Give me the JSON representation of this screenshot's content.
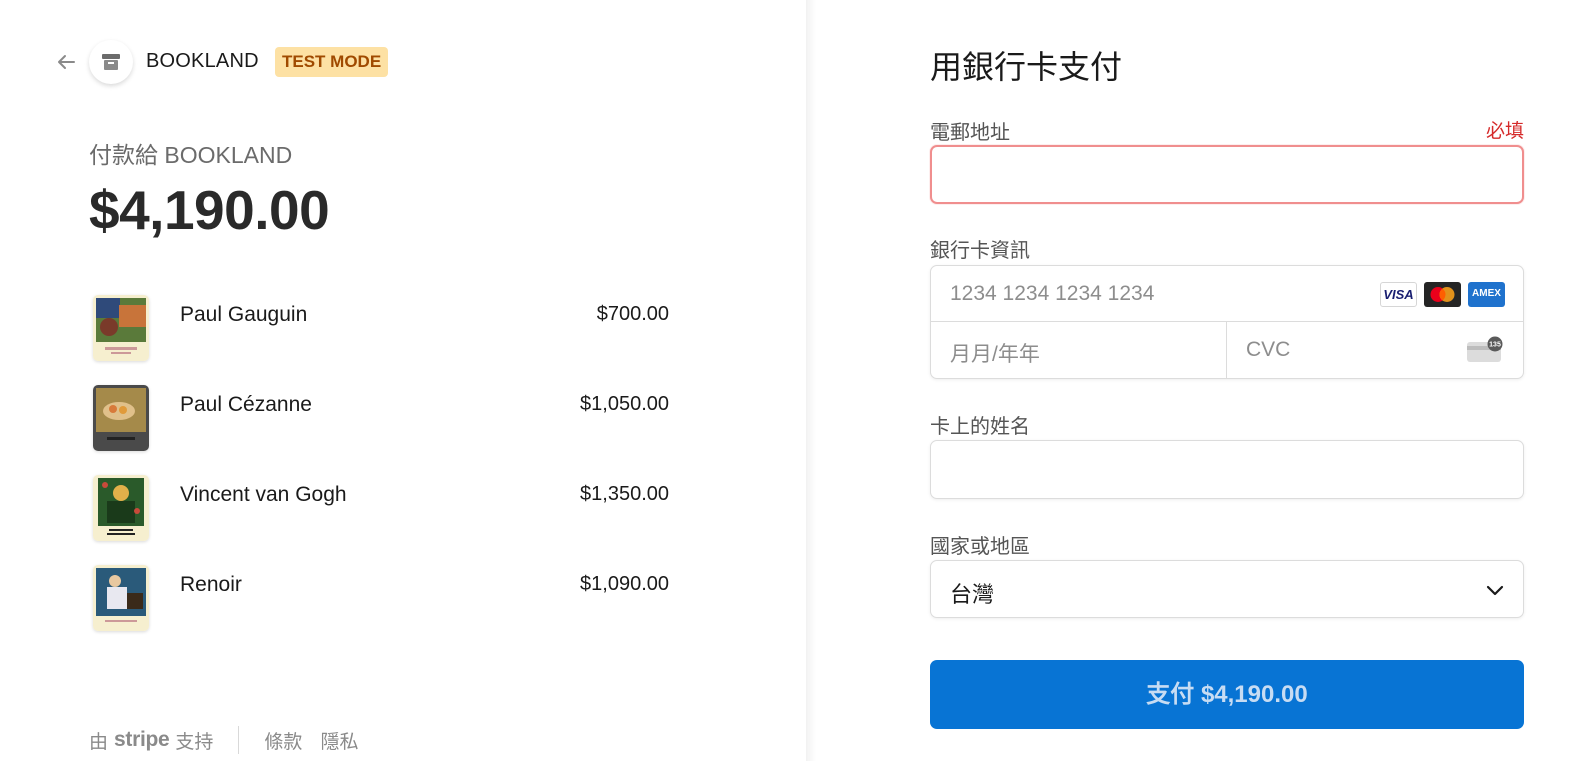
{
  "merchant": {
    "name": "BOOKLAND",
    "badge": "TEST MODE"
  },
  "summary": {
    "pay_to": "付款給 BOOKLAND",
    "total": "$4,190.00"
  },
  "items": [
    {
      "name": "Paul Gauguin",
      "price": "$700.00"
    },
    {
      "name": "Paul Cézanne",
      "price": "$1,050.00"
    },
    {
      "name": "Vincent van Gogh",
      "price": "$1,350.00"
    },
    {
      "name": "Renoir",
      "price": "$1,090.00"
    }
  ],
  "footer": {
    "powered_prefix": "由",
    "powered_brand": "stripe",
    "powered_suffix": "支持",
    "terms": "條款",
    "privacy": "隱私"
  },
  "form": {
    "title": "用銀行卡支付",
    "email_label": "電郵地址",
    "email_required": "必填",
    "email_value": "",
    "card_label": "銀行卡資訊",
    "card_number_placeholder": "1234 1234 1234 1234",
    "expiry_placeholder": "月月/年年",
    "cvc_placeholder": "CVC",
    "name_label": "卡上的姓名",
    "name_value": "",
    "country_label": "國家或地區",
    "country_value": "台灣",
    "pay_button": "支付 $4,190.00"
  },
  "card_brands": [
    "VISA",
    "Mastercard",
    "AMEX"
  ],
  "cvc_hint_number": "135",
  "colors": {
    "accent": "#0874d4",
    "error": "#d52a2a",
    "badge_bg": "#fde1a4",
    "badge_text": "#a04a00"
  }
}
